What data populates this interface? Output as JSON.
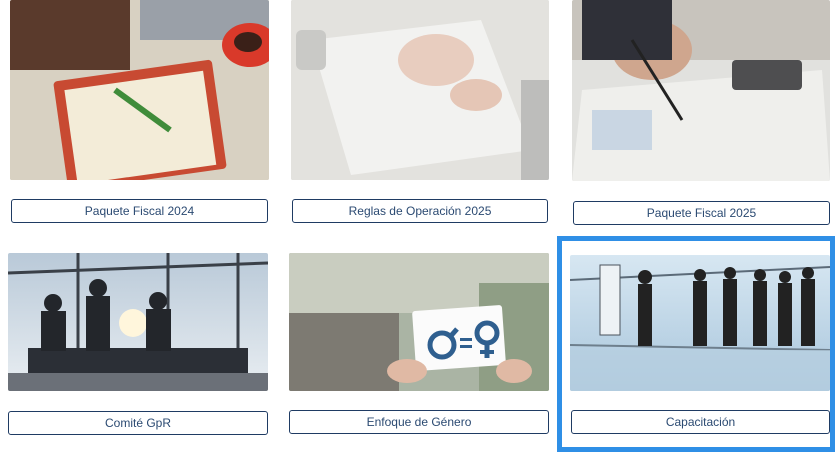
{
  "cards": [
    {
      "label": "Paquete Fiscal 2024",
      "image": "desk-notebook-coffee-photo"
    },
    {
      "label": "Reglas de Operación 2025",
      "image": "hands-paperwork-photo"
    },
    {
      "label": "Paquete Fiscal 2025",
      "image": "calculator-charts-photo"
    },
    {
      "label": "Comité GpR",
      "image": "meeting-silhouettes-photo"
    },
    {
      "label": "Enfoque de Género",
      "image": "gender-symbols-sign-photo"
    },
    {
      "label": "Capacitación",
      "image": "training-presentation-photo"
    }
  ],
  "selected_card": "Capacitación",
  "colors": {
    "button_border": "#1f3b63",
    "button_text": "#2b4a72",
    "highlight": "#2f8fe6"
  }
}
